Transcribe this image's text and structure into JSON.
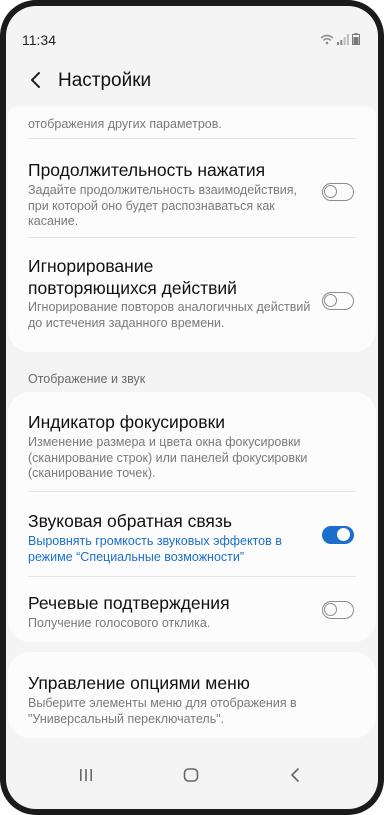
{
  "status_bar": {
    "time": "11:34"
  },
  "header": {
    "title": "Настройки"
  },
  "card1": {
    "clipped_text": "отображения других параметров.",
    "items": [
      {
        "title": "Продолжительность нажатия",
        "subtitle": "Задайте продолжительность взаимодействия, при которой оно будет распознаваться как касание.",
        "toggle": false
      },
      {
        "title": "Игнорирование повторяющихся действий",
        "subtitle": "Игнорирование повторов аналогичных действий до истечения заданного времени.",
        "toggle": false
      }
    ]
  },
  "section": {
    "label": "Отображение и звук"
  },
  "card2": {
    "items": [
      {
        "title": "Индикатор фокусировки",
        "subtitle": "Изменение размера и цвета окна фокусировки (сканирование строк) или панелей фокусировки (сканирование точек)."
      },
      {
        "title": "Звуковая обратная связь",
        "subtitle": "Выровнять громкость звуковых эффектов в режиме “Специальные возможности”",
        "toggle": true
      },
      {
        "title": "Речевые подтверждения",
        "subtitle": "Получение голосового отклика.",
        "toggle": false
      }
    ]
  },
  "card3": {
    "items": [
      {
        "title": "Управление опциями меню",
        "subtitle": "Выберите элементы меню для отображения в \"Универсальный переключатель\"."
      }
    ]
  },
  "colors": {
    "accent": "#1b6fcc",
    "background": "#f4f4f4",
    "card": "#fcfcfc"
  },
  "icons": {
    "back": "chevron-left-icon",
    "wifi": "wifi-icon",
    "signal": "signal-icon",
    "battery": "battery-icon",
    "recents": "recents-icon",
    "home": "home-icon",
    "nav_back": "back-icon"
  }
}
